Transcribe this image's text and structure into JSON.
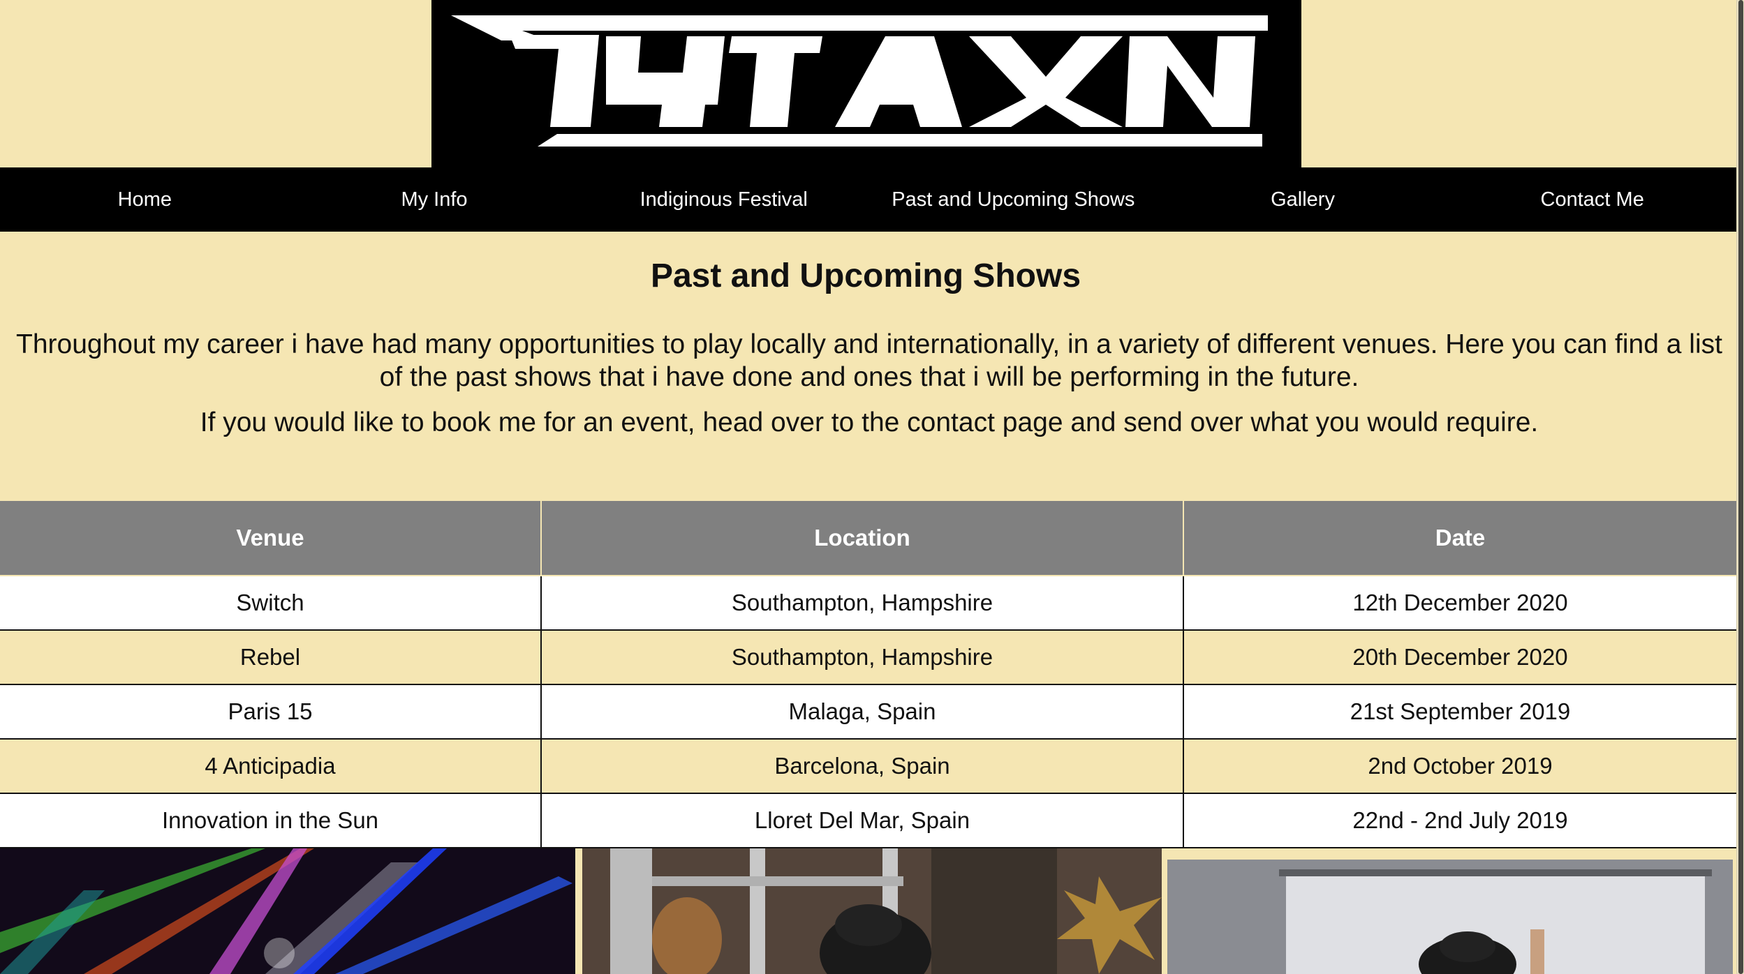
{
  "logo": {
    "alt": "TYTAN",
    "background": "#000000"
  },
  "nav": {
    "items": [
      {
        "label": "Home"
      },
      {
        "label": "My Info"
      },
      {
        "label": "Indiginous Festival"
      },
      {
        "label": "Past and Upcoming Shows"
      },
      {
        "label": "Gallery"
      },
      {
        "label": "Contact Me"
      }
    ]
  },
  "main": {
    "title": "Past and Upcoming Shows",
    "intro_1": "Throughout my career i have had many opportunities to play locally and internationally, in a variety of different venues. Here you can find a list of the past shows that i have done and ones that i will be performing in the future.",
    "intro_2": "If you would like to book me for an event, head over to the contact page and send over what you would require."
  },
  "shows_table": {
    "headers": [
      "Venue",
      "Location",
      "Date"
    ],
    "rows": [
      [
        "Switch",
        "Southampton, Hampshire",
        "12th December 2020"
      ],
      [
        "Rebel",
        "Southampton, Hampshire",
        "20th December 2020"
      ],
      [
        "Paris 15",
        "Malaga, Spain",
        "21st September 2019"
      ],
      [
        "4 Anticipadia",
        "Barcelona, Spain",
        "2nd October 2019"
      ],
      [
        "Innovation in the Sun",
        "Lloret Del Mar, Spain",
        "22nd - 2nd July 2019"
      ]
    ]
  },
  "gallery": {
    "photos": [
      {
        "subject": "club-lasers-photo"
      },
      {
        "subject": "dj-behind-scaffold-photo"
      },
      {
        "subject": "dj-at-projector-screen-photo"
      }
    ]
  },
  "colors": {
    "page_background": "#f5e6b3",
    "nav_background": "#000000",
    "table_header": "#808080",
    "row_alt": "#f5e6b3",
    "row_base": "#ffffff"
  }
}
